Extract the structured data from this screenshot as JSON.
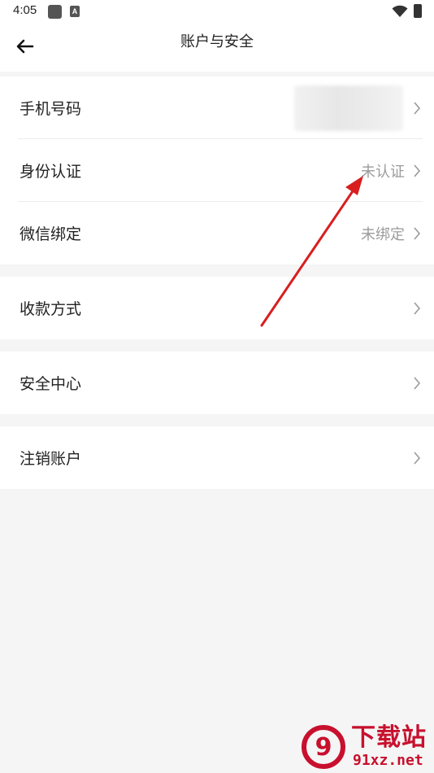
{
  "status_bar": {
    "time": "4:05",
    "icons": [
      "notification-square-icon",
      "a-badge-icon",
      "wifi-icon",
      "battery-charging-icon"
    ]
  },
  "header": {
    "title": "账户与安全",
    "back_icon": "arrow-left-icon"
  },
  "sections": [
    {
      "rows": [
        {
          "label": "手机号码",
          "value": "",
          "value_blurred": true
        },
        {
          "label": "身份认证",
          "value": "未认证"
        },
        {
          "label": "微信绑定",
          "value": "未绑定"
        }
      ]
    },
    {
      "rows": [
        {
          "label": "收款方式",
          "value": ""
        }
      ]
    },
    {
      "rows": [
        {
          "label": "安全中心",
          "value": ""
        }
      ]
    },
    {
      "rows": [
        {
          "label": "注销账户",
          "value": ""
        }
      ]
    }
  ],
  "annotation": {
    "color": "#d81e1e",
    "points_to": "身份认证-value"
  },
  "watermark": {
    "logo_text": "9",
    "top_text": "下载站",
    "bottom_text": "91xz.net",
    "color": "#c8102e"
  },
  "colors": {
    "background": "#f5f5f5",
    "row_bg": "#ffffff",
    "value_text": "#9b9b9b",
    "label_text": "#222222"
  }
}
